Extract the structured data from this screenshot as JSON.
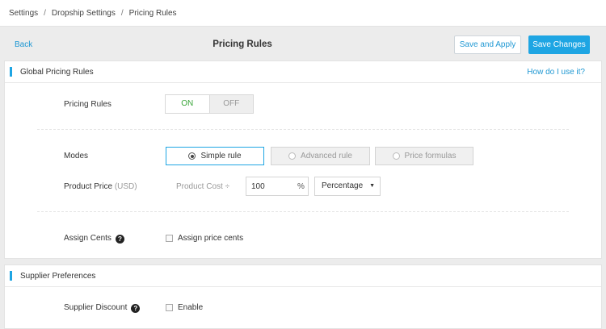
{
  "breadcrumb": {
    "items": [
      "Settings",
      "Dropship Settings",
      "Pricing Rules"
    ],
    "sep": "/"
  },
  "header": {
    "back": "Back",
    "title": "Pricing Rules",
    "save_apply": "Save and Apply",
    "save_changes": "Save Changes"
  },
  "global_card": {
    "title": "Global Pricing Rules",
    "help_link": "How do I use it?",
    "pricing_rules_label": "Pricing Rules",
    "toggle_on": "ON",
    "toggle_off": "OFF",
    "toggle_state": "ON",
    "modes_label": "Modes",
    "modes": [
      "Simple rule",
      "Advanced rule",
      "Price formulas"
    ],
    "selected_mode": "Simple rule",
    "product_price_label": "Product Price",
    "product_price_currency": "(USD)",
    "cost_label": "Product Cost ÷",
    "cost_value": "100",
    "percent_symbol": "%",
    "calc_select": "Percentage",
    "assign_cents_label": "Assign Cents",
    "assign_cents_checkbox": "Assign price cents",
    "assign_cents_checked": false
  },
  "supplier_card": {
    "title": "Supplier Preferences",
    "discount_label": "Supplier Discount",
    "enable_label": "Enable",
    "enable_checked": false
  },
  "icons": {
    "help": "help-circle-icon",
    "caret": "caret-down-icon",
    "radio": "radio-icon"
  },
  "colors": {
    "accent": "#1ea5e3",
    "on_text": "#3aa53a",
    "link": "#1f98d3"
  }
}
